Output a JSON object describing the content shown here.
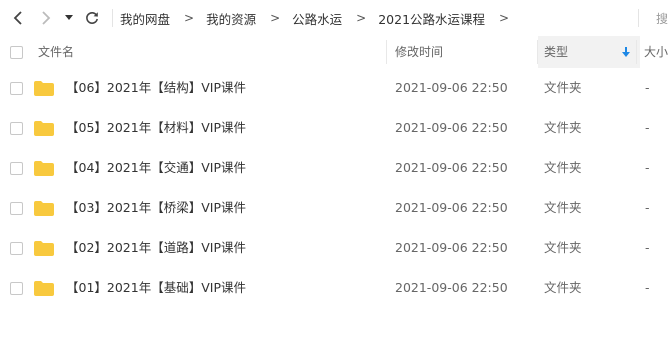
{
  "toolbar": {
    "back_icon": "chevron-left-icon",
    "forward_icon": "chevron-right-icon",
    "history_icon": "dropdown-arrow-icon",
    "refresh_icon": "refresh-icon",
    "search_hint": "搜"
  },
  "breadcrumb": [
    {
      "label": "我的网盘"
    },
    {
      "label": "我的资源"
    },
    {
      "label": "公路水运"
    },
    {
      "label": "2021公路水运课程"
    }
  ],
  "breadcrumb_separator": ">",
  "columns": {
    "name": "文件名",
    "modified": "修改时间",
    "type": "类型",
    "size": "大小"
  },
  "sort": {
    "column": "type",
    "direction": "descending",
    "icon": "sort-down-arrow-icon",
    "color": "#1e88e5"
  },
  "folder_color": "#f8c93e",
  "files": [
    {
      "name": "【06】2021年【结构】VIP课件",
      "modified": "2021-09-06 22:50",
      "type": "文件夹",
      "size": "-"
    },
    {
      "name": "【05】2021年【材料】VIP课件",
      "modified": "2021-09-06 22:50",
      "type": "文件夹",
      "size": "-"
    },
    {
      "name": "【04】2021年【交通】VIP课件",
      "modified": "2021-09-06 22:50",
      "type": "文件夹",
      "size": "-"
    },
    {
      "name": "【03】2021年【桥梁】VIP课件",
      "modified": "2021-09-06 22:50",
      "type": "文件夹",
      "size": "-"
    },
    {
      "name": "【02】2021年【道路】VIP课件",
      "modified": "2021-09-06 22:50",
      "type": "文件夹",
      "size": "-"
    },
    {
      "name": "【01】2021年【基础】VIP课件",
      "modified": "2021-09-06 22:50",
      "type": "文件夹",
      "size": "-"
    }
  ]
}
